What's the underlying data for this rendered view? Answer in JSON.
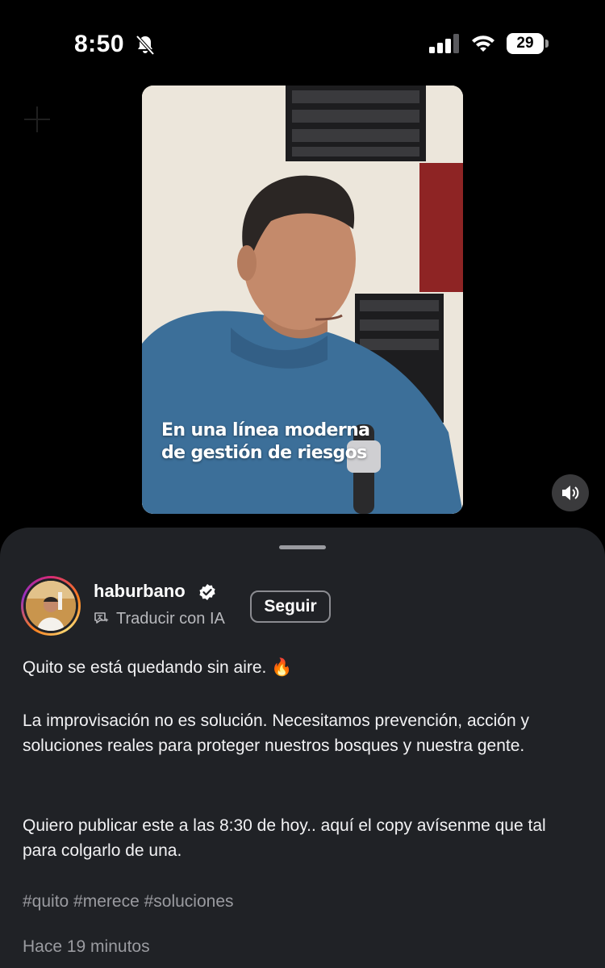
{
  "status_bar": {
    "time": "8:50",
    "battery_level": "29",
    "icons": [
      "bell-slash-icon",
      "cellular-signal-icon",
      "wifi-icon",
      "battery-icon"
    ]
  },
  "video": {
    "caption_line1": "En una línea moderna",
    "caption_line2": "de gestión de riesgos",
    "mute_icon": "speaker-icon"
  },
  "post": {
    "username": "haburbano",
    "verified": true,
    "translate_label": "Traducir con IA",
    "follow_label": "Seguir",
    "paragraph1": "Quito se está quedando sin aire. 🔥",
    "paragraph2": "La improvisación no es solución. Necesitamos prevención, acción y soluciones reales para proteger nuestros bosques y nuestra gente.",
    "paragraph3": "Quiero publicar este a las 8:30 de hoy.. aquí el copy avísenme que tal para colgarlo de una.",
    "hashtags": "#quito #merece #soluciones",
    "timestamp": "Hace 19 minutos"
  },
  "colors": {
    "background": "#000000",
    "sheet": "#202226",
    "secondary_text": "#9a9ba0",
    "verified_badge": "#ffffff"
  }
}
